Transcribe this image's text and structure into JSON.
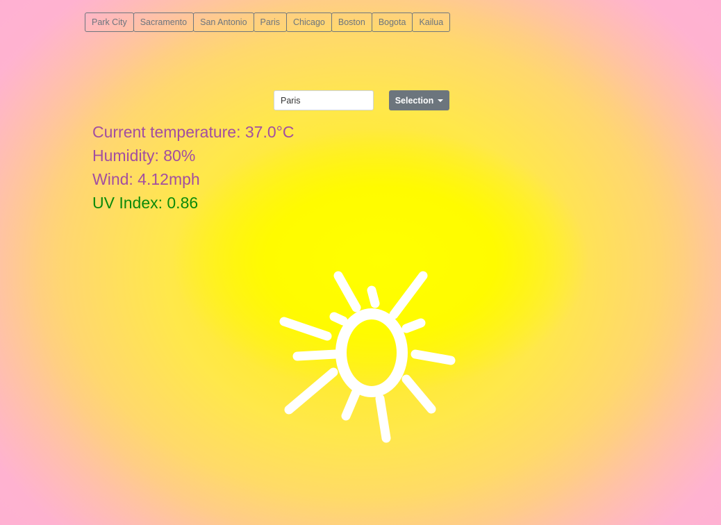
{
  "cities": [
    "Park City",
    "Sacramento",
    "San Antonio",
    "Paris",
    "Chicago",
    "Boston",
    "Bogota",
    "Kailua"
  ],
  "search": {
    "value": "Paris"
  },
  "selection_button": {
    "label": "Selection"
  },
  "weather": {
    "temperature": "Current temperature: 37.0°C",
    "humidity": "Humidity: 80%",
    "wind": "Wind: 4.12mph",
    "uv": "UV Index: 0.86"
  },
  "colors": {
    "stat_text": "#a24ea0",
    "uv_text": "#0a8a0a",
    "button_gray": "#6c757d",
    "sun_glow": "#ffff00"
  },
  "icons": {
    "weather": "sun-icon",
    "dropdown": "caret-down-icon"
  }
}
